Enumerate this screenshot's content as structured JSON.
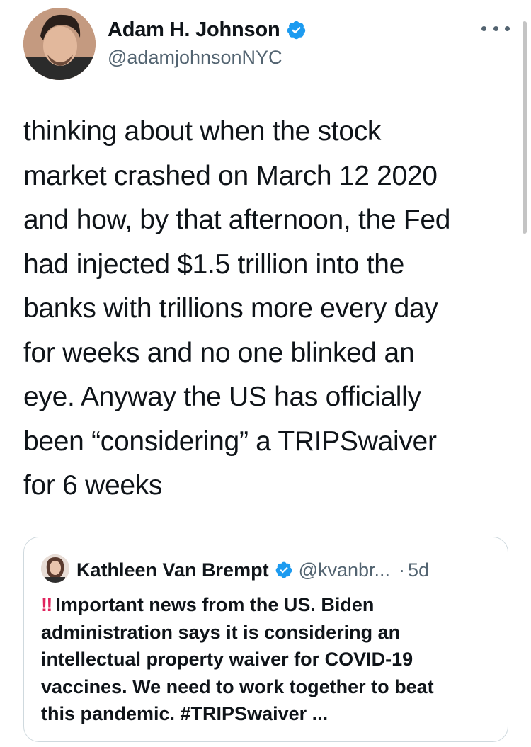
{
  "author": {
    "name": "Adam H. Johnson",
    "handle": "@adamjohnsonNYC",
    "verified_icon": "verified-badge",
    "verified_color": "#1d9bf0"
  },
  "more_icon": "more-options-icon",
  "tweet": {
    "lines": [
      "thinking about when the stock",
      "market crashed on March 12 2020",
      "and how, by that afternoon, the Fed",
      "had injected $1.5 trillion into the",
      "banks with trillions more every day",
      "for weeks and no one blinked an",
      "eye. Anyway the US has officially",
      "been “considering” a TRIPSwaiver",
      "for 6 weeks"
    ]
  },
  "quote": {
    "name": "Kathleen Van Brempt",
    "handle": "@kvanbr...",
    "separator": "·",
    "time": "5d",
    "emoji": "‼",
    "lines": [
      "Important news from the US. Biden",
      "administration says it is considering an",
      "intellectual property waiver for COVID-19",
      "vaccines. We need to work together to beat",
      "this pandemic. #TRIPSwaiver ..."
    ]
  },
  "colors": {
    "text": "#0f1419",
    "secondary": "#536471",
    "border": "#cfd9de",
    "emoji_red": "#e0245e"
  }
}
